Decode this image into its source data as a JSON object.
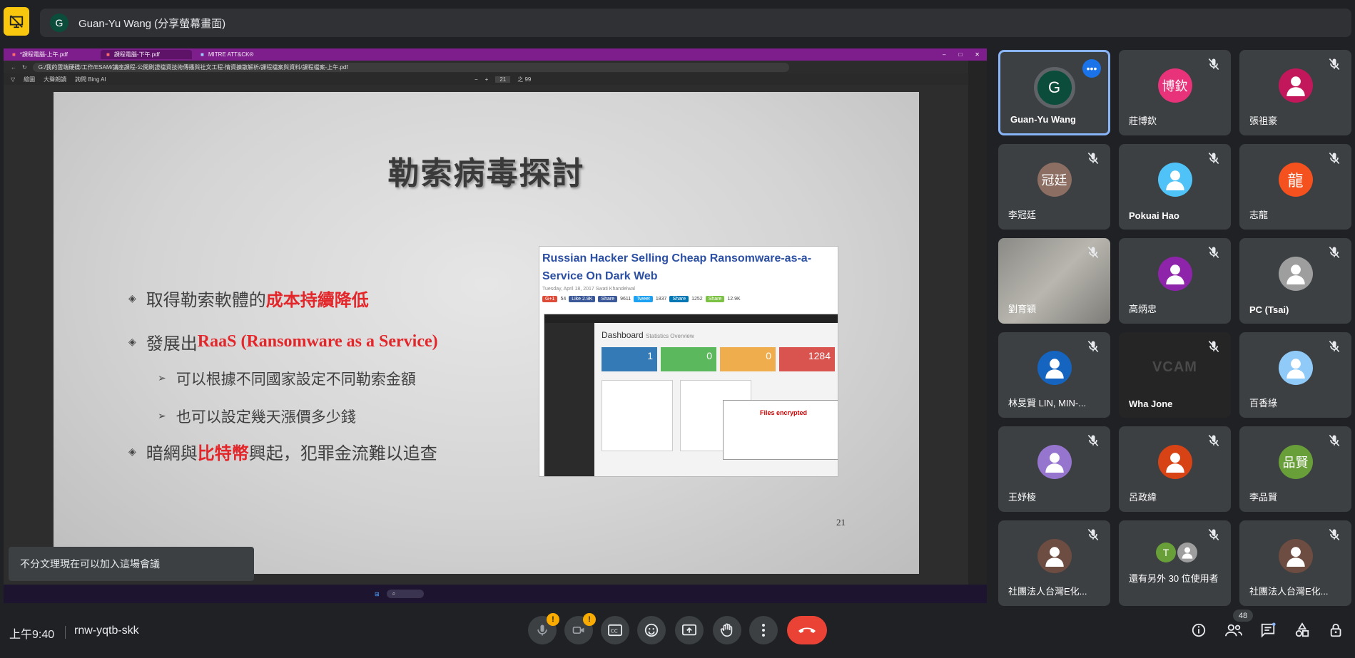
{
  "presenter": {
    "initial": "G",
    "banner_text": "Guan-Yu Wang (分享螢幕畫面)"
  },
  "browser": {
    "tabs": [
      {
        "label": "*課程電腦-上午.pdf"
      },
      {
        "label": "課程電腦-下午.pdf"
      },
      {
        "label": "MITRE ATT&CK®"
      }
    ],
    "url": "G:/我的雲端硬碟/工作/ESAM/講座課程-公開刷證檔資技術傳播與社文工程-情資擴散解析/課程檔案與資料/課程檔案-上午.pdf",
    "page_current": "21",
    "page_total": "之 99",
    "toolbar_draw": "繪圖",
    "toolbar_read": "大聲朗讀",
    "toolbar_ask": "詢問 Bing AI"
  },
  "slide": {
    "title": "勒索病毒探討",
    "bullet1_pre": "取得勒索軟體的",
    "bullet1_red": "成本持續降低",
    "bullet2_pre": "發展出",
    "bullet2_red": "RaaS (Ransomware as a Service)",
    "sub1": "可以根據不同國家設定不同勒索金額",
    "sub2": "也可以設定幾天漲價多少錢",
    "bullet3_pre": "暗網與",
    "bullet3_red": "比特幣",
    "bullet3_post": "興起，犯罪金流難以追查",
    "page_number": "21",
    "article": {
      "title": "Russian Hacker Selling Cheap Ransomware-as-a-Service On Dark Web",
      "meta": "Tuesday, April 18, 2017   Swati Khandelwal",
      "shares": [
        {
          "label": "G+1",
          "count": "54",
          "color": "#dd4b39"
        },
        {
          "label": "Like 2.9K",
          "count": "",
          "color": "#3b5998"
        },
        {
          "label": "Share",
          "count": "9611",
          "color": "#3b5998"
        },
        {
          "label": "Tweet",
          "count": "1837",
          "color": "#1da1f2"
        },
        {
          "label": "Share",
          "count": "1252",
          "color": "#0077b5"
        },
        {
          "label": "Share",
          "count": "12.9K",
          "color": "#7bc143"
        }
      ],
      "dashboard_title": "Dashboard",
      "dashboard_sub": "Statistics Overview",
      "tiles": [
        {
          "value": "1",
          "color": "#337ab7"
        },
        {
          "value": "0",
          "color": "#5cb85c"
        },
        {
          "value": "0",
          "color": "#f0ad4e"
        },
        {
          "value": "1284",
          "color": "#d9534f"
        }
      ],
      "popup_title": "Files encrypted"
    }
  },
  "toast": {
    "text": "不分文理現在可以加入這場會議"
  },
  "participants": [
    {
      "name": "Guan-Yu Wang",
      "initial": "G",
      "color": "#0b4c3b",
      "active": true
    },
    {
      "name": "莊博欽",
      "initial": "博欽",
      "color": "#e8337a"
    },
    {
      "name": "張祖豪",
      "initial": "",
      "color": "#c2185b"
    },
    {
      "name": "李冠廷",
      "initial": "冠廷",
      "color": "#8d6e63"
    },
    {
      "name": "Pokuai Hao",
      "initial": "",
      "color": "#4fc3f7"
    },
    {
      "name": "志龍",
      "initial": "龍",
      "color": "#f4511e"
    },
    {
      "name": "劉育穎",
      "initial": "",
      "color": ""
    },
    {
      "name": "高炳忠",
      "initial": "",
      "color": "#8e24aa"
    },
    {
      "name": "PC (Tsai)",
      "initial": "",
      "color": "#9e9e9e"
    },
    {
      "name": "林旻賢 LIN, MIN-...",
      "initial": "",
      "color": "#1565c0"
    },
    {
      "name": "Wha Jone",
      "initial": "VCAM",
      "color": ""
    },
    {
      "name": "百香綠",
      "initial": "",
      "color": "#90caf9"
    },
    {
      "name": "王妤棱",
      "initial": "",
      "color": "#9575cd"
    },
    {
      "name": "呂政緯",
      "initial": "",
      "color": "#d84315"
    },
    {
      "name": "李品賢",
      "initial": "品賢",
      "color": "#689f38"
    },
    {
      "name": "社團法人台灣E化...",
      "initial": "",
      "color": "#6d4c41"
    },
    {
      "name": "還有另外 30 位使用者",
      "initial": "T",
      "color": "#689f38"
    },
    {
      "name": "社團法人台灣E化...",
      "initial": "",
      "color": "#6d4c41"
    }
  ],
  "bottom": {
    "time": "上午9:40",
    "meeting_code": "rnw-yqtb-skk",
    "participant_count": "48",
    "warn_mark": "!"
  },
  "colors": {
    "accent": "#8ab4f8",
    "end_call": "#ea4335",
    "warn": "#f9ab00"
  }
}
